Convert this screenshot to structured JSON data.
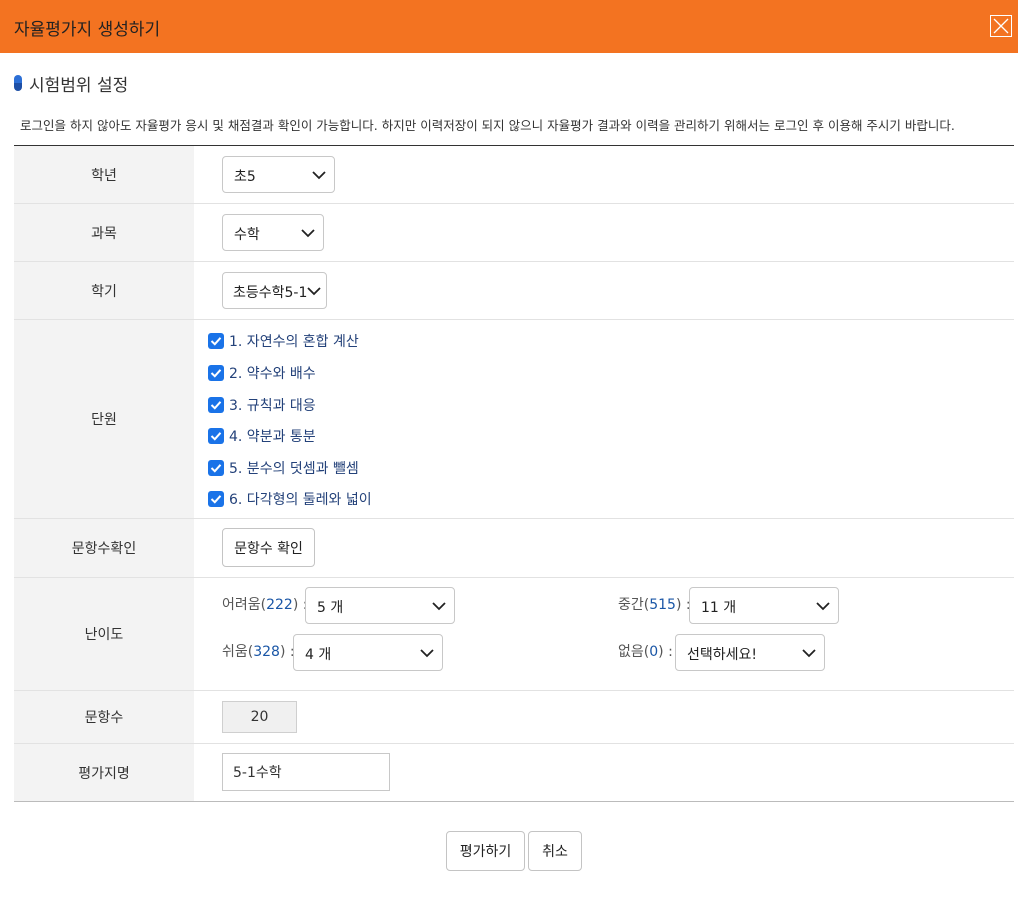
{
  "window": {
    "title": "자율평가지 생성하기"
  },
  "section": {
    "title": "시험범위 설정"
  },
  "notice": "로그인을 하지 않아도 자율평가 응시 및 채점결과 확인이 가능합니다. 하지만 이력저장이 되지 않으니 자율평가 결과와 이력을 관리하기 위해서는 로그인 후 이용해 주시기 바랍니다.",
  "form": {
    "grade": {
      "label": "학년",
      "value": "초5"
    },
    "subject": {
      "label": "과목",
      "value": "수학"
    },
    "semester": {
      "label": "학기",
      "value": "초등수학5-1"
    },
    "units": {
      "label": "단원",
      "items": [
        {
          "label": "1. 자연수의 혼합 계산",
          "checked": true
        },
        {
          "label": "2. 약수와 배수",
          "checked": true
        },
        {
          "label": "3. 규칙과 대응",
          "checked": true
        },
        {
          "label": "4. 약분과 통분",
          "checked": true
        },
        {
          "label": "5. 분수의 덧셈과 뺄셈",
          "checked": true
        },
        {
          "label": "6. 다각형의 둘레와 넓이",
          "checked": true
        }
      ]
    },
    "count_check": {
      "label": "문항수확인",
      "button": "문항수 확인"
    },
    "difficulty": {
      "label": "난이도",
      "hard": {
        "name": "어려움",
        "count": "222",
        "value": "5 개"
      },
      "medium": {
        "name": "중간",
        "count": "515",
        "value": "11 개"
      },
      "easy": {
        "name": "쉬움",
        "count": "328",
        "value": "4 개"
      },
      "none": {
        "name": "없음",
        "count": "0",
        "value": "선택하세요!"
      }
    },
    "question_count": {
      "label": "문항수",
      "value": "20"
    },
    "paper_name": {
      "label": "평가지명",
      "value": "5-1수학"
    }
  },
  "actions": {
    "submit": "평가하기",
    "cancel": "취소"
  },
  "colors": {
    "header": "#f37321",
    "accent": "#1a73e8",
    "link": "#1a56a6"
  }
}
